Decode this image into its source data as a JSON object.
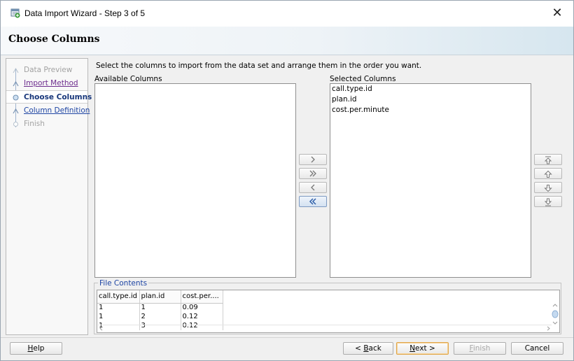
{
  "window": {
    "title": "Data Import Wizard - Step 3 of 5",
    "close_glyph": "✕"
  },
  "header": {
    "title": "Choose Columns"
  },
  "steps": [
    {
      "label": "Data Preview",
      "state": "disabled"
    },
    {
      "label": "Import Method",
      "state": "visited"
    },
    {
      "label": "Choose Columns",
      "state": "current"
    },
    {
      "label": "Column Definition",
      "state": "link"
    },
    {
      "label": "Finish",
      "state": "disabled"
    }
  ],
  "instructions": "Select the columns to import from the data set and arrange them in the order you want.",
  "available": {
    "label": "Available Columns",
    "items": []
  },
  "selected": {
    "label": "Selected Columns",
    "items": [
      "call.type.id",
      "plan.id",
      "cost.per.minute"
    ]
  },
  "shuttle_buttons": [
    {
      "name": "move-right-button",
      "icon": "single-chevron-right-icon"
    },
    {
      "name": "move-all-right-button",
      "icon": "double-chevron-right-icon"
    },
    {
      "name": "move-left-button",
      "icon": "single-chevron-left-icon"
    },
    {
      "name": "move-all-left-button",
      "icon": "double-chevron-left-icon",
      "active": true
    }
  ],
  "order_buttons": [
    {
      "name": "move-top-button",
      "icon": "arrow-to-top-icon"
    },
    {
      "name": "move-up-button",
      "icon": "arrow-up-icon"
    },
    {
      "name": "move-down-button",
      "icon": "arrow-down-icon"
    },
    {
      "name": "move-bottom-button",
      "icon": "arrow-to-bottom-icon"
    }
  ],
  "file_contents": {
    "legend": "File Contents",
    "columns": [
      "call.type.id",
      "plan.id",
      "cost.per...."
    ],
    "rows": [
      [
        "1",
        "1",
        "0.09"
      ],
      [
        "1",
        "2",
        "0.12"
      ],
      [
        "1",
        "3",
        "0.12"
      ]
    ]
  },
  "buttons": {
    "help": {
      "text": "Help",
      "mnemonic": "H"
    },
    "back": {
      "prefix": "< ",
      "mnemonic": "B",
      "rest": "ack"
    },
    "next": {
      "mnemonic": "N",
      "rest": "ext >"
    },
    "finish": {
      "mnemonic": "F",
      "rest": "inish"
    },
    "cancel": {
      "text": "Cancel"
    }
  },
  "colors": {
    "link": "#1d44a3",
    "visited": "#6c2b8c",
    "current_step": "#17367a",
    "default_button_border": "#e0a64a"
  }
}
